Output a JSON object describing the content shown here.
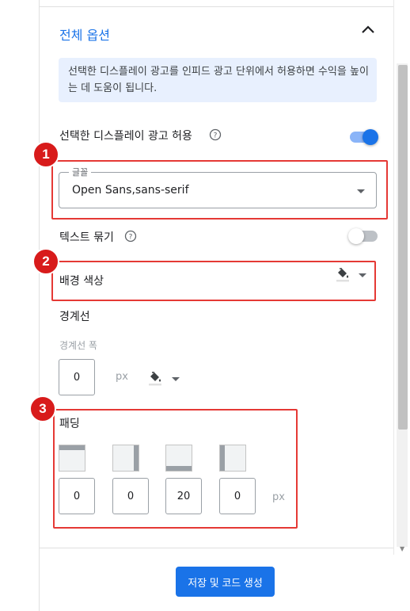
{
  "section": {
    "title": "전체 옵션",
    "info_text": "선택한 디스플레이 광고를 인피드 광고 단위에서 허용하면 수익을 높이는 데 도움이 됩니다."
  },
  "allow_display_ads": {
    "label": "선택한 디스플레이 광고 허용",
    "enabled": true
  },
  "font": {
    "legend": "글꼴",
    "value": "Open Sans,sans-serif"
  },
  "text_wrap": {
    "label": "텍스트 묶기",
    "enabled": false
  },
  "background_color": {
    "label": "배경 색상"
  },
  "border": {
    "label": "경계선",
    "width_label": "경계선 폭",
    "width_value": "0",
    "unit": "px"
  },
  "padding": {
    "label": "패딩",
    "top": "0",
    "right": "0",
    "bottom": "20",
    "left": "0",
    "unit": "px"
  },
  "save_button": {
    "label": "저장 및 코드 생성"
  },
  "badges": [
    "1",
    "2",
    "3"
  ],
  "colors": {
    "accent": "#1a73e8",
    "highlight_red": "#e53935",
    "badge_red": "#d81b1b",
    "info_bg": "#e8f0fe"
  }
}
